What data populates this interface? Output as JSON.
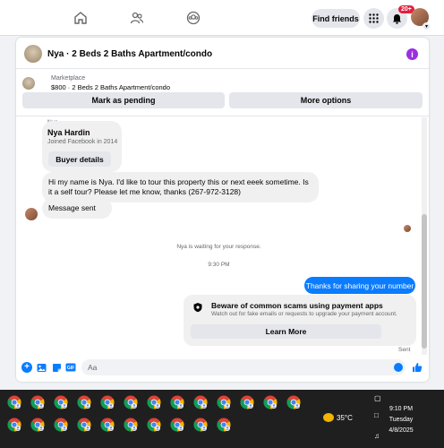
{
  "nav": {
    "find_friends": "Find friends",
    "notifications_badge": "20+"
  },
  "thread": {
    "title": "Nya · 2 Beds 2 Baths Apartment/condo",
    "listing_source": "Marketplace",
    "listing_price": "$800 · 2 Beds 2 Baths Apartment/condo",
    "mark_pending": "Mark as pending",
    "more_options": "More options"
  },
  "messages": {
    "sender_label": "Nya",
    "card_name": "Nya Hardin",
    "card_joined": "Joined Facebook in 2014",
    "buyer_details": "Buyer details",
    "inquiry": "Hi my name is Nya. I'd like to tour this property this or next eeek sometime. Is it a self tour? Please let me know, thanks (267-972-3128)",
    "message_sent": "Message sent",
    "waiting": "Nya is waiting for your response.",
    "time": "9:30 PM",
    "my_reply": "Thanks for sharing your number",
    "scam_title": "Beware of common scams using payment apps",
    "scam_desc": "Watch out for fake emails or requests to upgrade your payment account.",
    "learn_more": "Learn More",
    "status": "Sent"
  },
  "composer": {
    "placeholder": "Aa"
  },
  "taskbar": {
    "weather_temp": "35°C",
    "time": "9:10 PM",
    "day": "Tuesday",
    "date": "4/8/2025",
    "pinned_apps": [
      "chrome-icon",
      "chrome-icon",
      "chrome-icon",
      "chrome-icon",
      "chrome-icon",
      "chrome-icon",
      "chrome-icon",
      "chrome-icon",
      "chrome-icon",
      "chrome-icon",
      "chrome-icon",
      "chrome-icon",
      "chrome-icon",
      "chrome-icon",
      "chrome-icon",
      "chrome-icon",
      "chrome-icon",
      "chrome-icon",
      "chrome-icon",
      "chrome-icon",
      "chrome-icon",
      "chrome-icon",
      "chrome-icon"
    ]
  },
  "colors": {
    "accent": "#0a7cff",
    "info": "#9b2fe0",
    "badge": "#e41e3f",
    "taskbar": "#201f1f"
  }
}
